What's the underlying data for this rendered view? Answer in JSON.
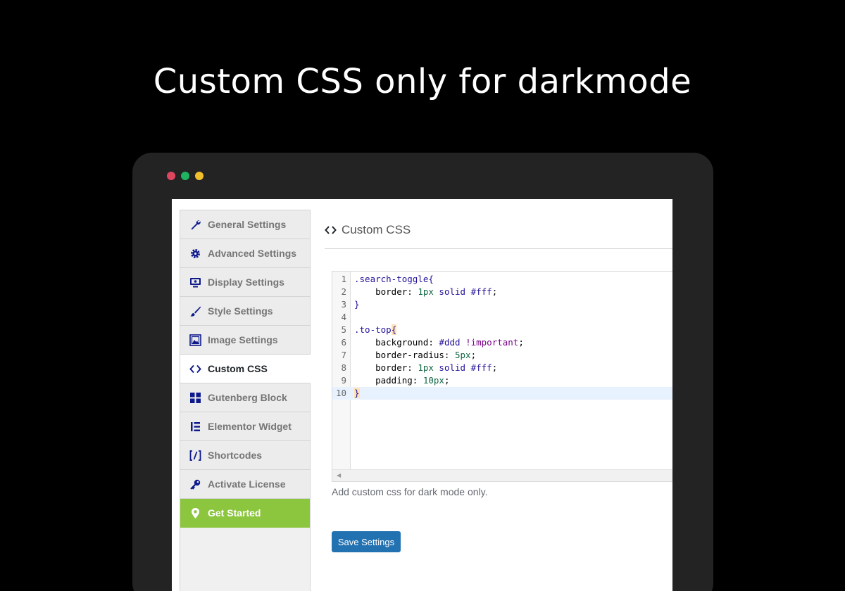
{
  "headline": "Custom CSS only for darkmode",
  "window_dots": {
    "red": "#e0455f",
    "green": "#1fb35f",
    "yellow": "#f0c02c"
  },
  "sidebar": {
    "items": [
      {
        "label": "General Settings",
        "icon": "wrench-icon"
      },
      {
        "label": "Advanced Settings",
        "icon": "gear-icon"
      },
      {
        "label": "Display Settings",
        "icon": "monitor-icon"
      },
      {
        "label": "Style Settings",
        "icon": "paintbrush-icon"
      },
      {
        "label": "Image Settings",
        "icon": "image-icon"
      },
      {
        "label": "Custom CSS",
        "icon": "code-icon",
        "active": true
      },
      {
        "label": "Gutenberg Block",
        "icon": "grid-icon"
      },
      {
        "label": "Elementor Widget",
        "icon": "elementor-icon"
      },
      {
        "label": "Shortcodes",
        "icon": "shortcode-icon"
      },
      {
        "label": "Activate License",
        "icon": "key-icon"
      },
      {
        "label": "Get Started",
        "icon": "location-pin-icon",
        "highlight": true
      }
    ],
    "accent_color": "#8cc63f",
    "icon_color": "#0e1a8c"
  },
  "main": {
    "title": "Custom CSS",
    "editor": {
      "lines": [
        {
          "n": "1",
          "tokens": [
            [
              "sel",
              ".search-toggle"
            ],
            [
              "sel",
              "{"
            ]
          ]
        },
        {
          "n": "2",
          "tokens": [
            [
              "prop",
              "    border: "
            ],
            [
              "num",
              "1px"
            ],
            [
              "prop",
              " "
            ],
            [
              "sel",
              "solid #fff"
            ],
            [
              "prop",
              ";"
            ]
          ]
        },
        {
          "n": "3",
          "tokens": [
            [
              "sel",
              "}"
            ]
          ]
        },
        {
          "n": "4",
          "tokens": []
        },
        {
          "n": "5",
          "tokens": [
            [
              "sel",
              ".to-top"
            ],
            [
              "hl",
              "{"
            ]
          ]
        },
        {
          "n": "6",
          "tokens": [
            [
              "prop",
              "    background: "
            ],
            [
              "sel",
              "#ddd"
            ],
            [
              "prop",
              " "
            ],
            [
              "kw",
              "!important"
            ],
            [
              "prop",
              ";"
            ]
          ]
        },
        {
          "n": "7",
          "tokens": [
            [
              "prop",
              "    border-radius: "
            ],
            [
              "num",
              "5px"
            ],
            [
              "prop",
              ";"
            ]
          ]
        },
        {
          "n": "8",
          "tokens": [
            [
              "prop",
              "    border: "
            ],
            [
              "num",
              "1px"
            ],
            [
              "prop",
              " "
            ],
            [
              "sel",
              "solid #fff"
            ],
            [
              "prop",
              ";"
            ]
          ]
        },
        {
          "n": "9",
          "tokens": [
            [
              "prop",
              "    padding: "
            ],
            [
              "num",
              "10px"
            ],
            [
              "prop",
              ";"
            ]
          ]
        },
        {
          "n": "10",
          "tokens": [
            [
              "hl",
              "}"
            ]
          ],
          "current": true
        }
      ]
    },
    "help_text": "Add custom css for dark mode only.",
    "save_label": "Save Settings",
    "button_color": "#2271b1"
  }
}
